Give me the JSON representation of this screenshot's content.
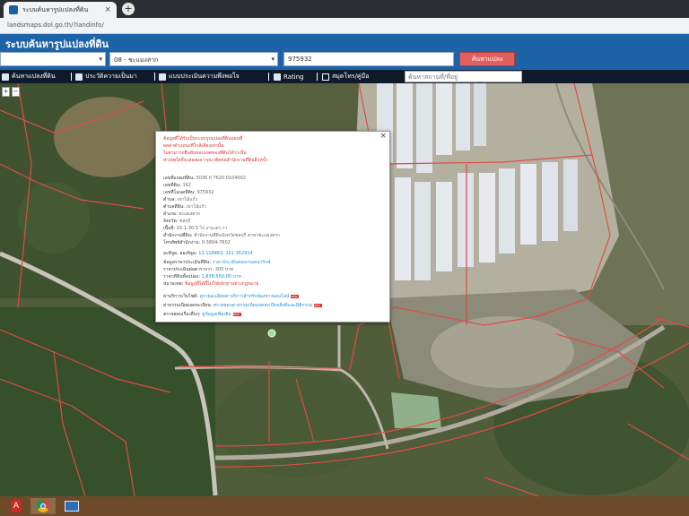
{
  "browser": {
    "tab_title": "ระบบค้นหารูปแปลงที่ดิน",
    "tab_close": "×",
    "new_tab": "+",
    "url": "landsmaps.dol.go.th/?landinfo/"
  },
  "app": {
    "title": "ระบบค้นหารูปแปลงที่ดิน"
  },
  "search": {
    "province_value": "",
    "district_value": "08 - ชะแมงสาก",
    "parcel_value": "975932",
    "search_label": "ค้นหาแปลง",
    "caret": "▾"
  },
  "toolbar": {
    "items": [
      {
        "label": "ค้นหาแปลงที่ดิน"
      },
      {
        "label": "ประวัติความเป็นมา"
      },
      {
        "label": "แบบประเมินความพึงพอใจ"
      },
      {
        "label": "Rating"
      },
      {
        "label": "สมุดโทร/คู่มือ"
      }
    ],
    "map_search_placeholder": "ค้นหาสถานที่/ที่อยู่"
  },
  "map_controls": {
    "zoom_in": "+",
    "zoom_out": "−"
  },
  "popup": {
    "close": "×",
    "warnings": [
      "ข้อมูลที่ได้รับเป็นระบบรูปแปลงที่ดินแผนที่",
      "ผลค่าตำแหน่งที่ใกล้เคียงเท่านั้น",
      "ไม่สามารถยืนยันขอบเขตของที่ดินได้ว่าเป็น",
      "สาเหตุใดจึงแสดงผล กรุณาติดต่อสำนักงานที่ดินอีกครั้ง"
    ],
    "rows": [
      {
        "label": "เลขที่แปลงที่ดิน:",
        "value": "5036 II 7620 0104002",
        "style": "gray"
      },
      {
        "label": "เลขที่ดิน:",
        "value": "162",
        "style": "gray"
      },
      {
        "label": "เลขที่โฉนดที่ดิน:",
        "value": "975932",
        "style": "gray"
      },
      {
        "label": "ตำบล:",
        "value": "เขาไม้แก้ว",
        "style": "gray"
      },
      {
        "label": "ตำบลที่ดิน:",
        "value": "เขาไม้แก้ว",
        "style": "gray"
      },
      {
        "label": "อำเภอ:",
        "value": "ชะแมงสาก",
        "style": "gray"
      },
      {
        "label": "จังหวัด:",
        "value": "ชลบุรี",
        "style": "gray"
      },
      {
        "label": "เนื้อที่:",
        "value": "15-1-30.5 ไร่-งาน-ตร.วา",
        "style": "gray"
      },
      {
        "label": "สำนักงานที่ดิน:",
        "value": "สำนักงานที่ดินจังหวัดชลบุรี สาขาชะแมงสาก",
        "style": "gray"
      },
      {
        "label": "โทรศัพท์สำนักงาน:",
        "value": "0-3804-7602",
        "style": "gray"
      },
      {
        "label": "ละติจูด, ลองจิจูด:",
        "value": "13.118463, 101.352914",
        "style": "blue"
      },
      {
        "label": "ข้อมูลราคาประเมินที่ดิน:",
        "value": "ราคาประเมินของกรมธนารักษ์",
        "style": "blue"
      },
      {
        "label": "ราคาประเมินต่อตารางวา:",
        "value": "300 บาท",
        "style": "gray"
      },
      {
        "label": "ราคาที่ดินทั้งแปลง:",
        "value": "1,838,550.00 บาท",
        "style": "blue"
      },
      {
        "label": "หมายเหตุ:",
        "value": "ข้อมูลที่ได้นี้ไม่ใช่หลักฐานทางกฎหมาย",
        "style": "red"
      }
    ],
    "links": [
      {
        "label": "ค่าบริการเว็บไซต์:",
        "value": "ดูรายละเอียดค่าบริการสำหรับช่องทางออนไลน์",
        "tag": "NEW"
      },
      {
        "label": "ค่าธรรมเนียมจดทะเบียน:",
        "value": "ตรวจสอบค่าธรรมเนียมจดทะเบียนสิทธิและนิติกรรม",
        "tag": "NEW"
      },
      {
        "label": "ตรวจสอบเรื่องอื่นๆ:",
        "value": "ดูข้อมูลเพิ่มเติม",
        "tag": "NEW"
      }
    ]
  },
  "taskbar": {
    "pdf_label": "A",
    "items": [
      "pdf-reader",
      "chrome",
      "window"
    ]
  }
}
